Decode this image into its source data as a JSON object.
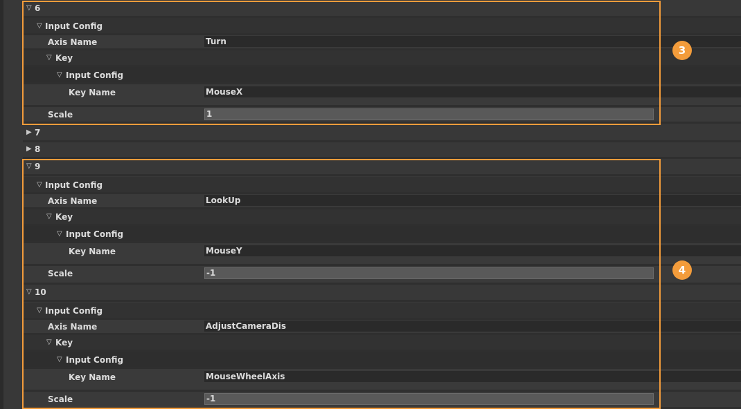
{
  "elements": [
    {
      "index": "6",
      "axis_name": "Turn",
      "key_name": "MouseX",
      "scale": "1"
    },
    {
      "index": "9",
      "axis_name": "LookUp",
      "key_name": "MouseY",
      "scale": "-1"
    },
    {
      "index": "10",
      "axis_name": "AdjustCameraDis",
      "key_name": "MouseWheelAxis",
      "scale": "-1"
    }
  ],
  "collapsed": [
    "7",
    "8"
  ],
  "labels": {
    "input_config": "Input Config",
    "axis_name": "Axis Name",
    "key": "Key",
    "key_name": "Key Name",
    "scale": "Scale"
  },
  "badges": {
    "b3": "3",
    "b4": "4"
  },
  "icons": {
    "expanded": "triangle-down-icon",
    "collapsed": "triangle-right-icon"
  },
  "colors": {
    "highlight": "#f39c3b",
    "badge": "#f39c3b"
  }
}
